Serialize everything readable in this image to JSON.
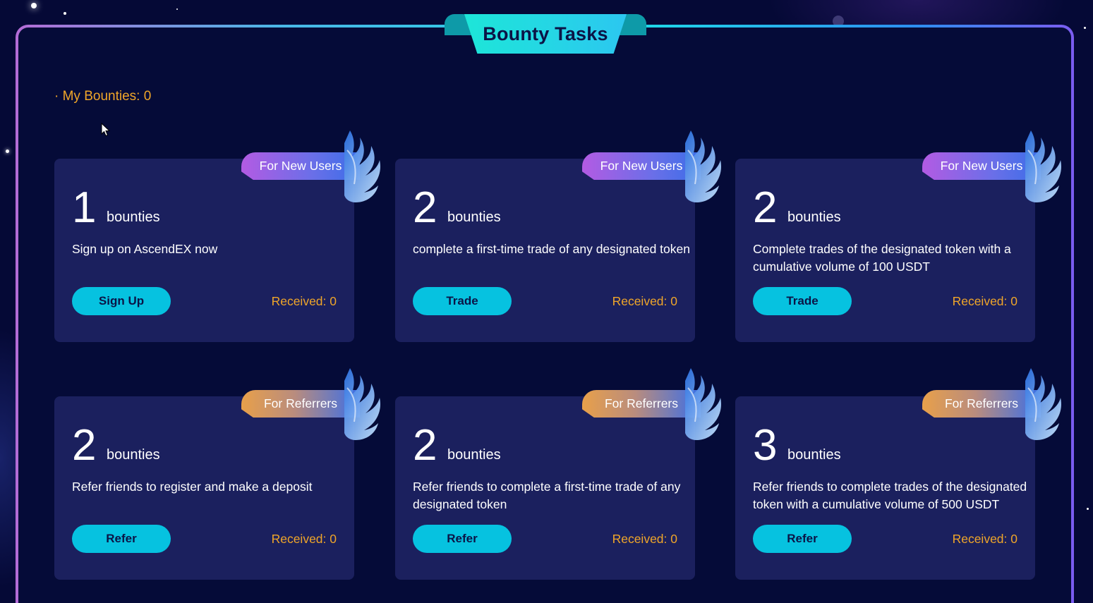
{
  "header": {
    "title": "Bounty Tasks"
  },
  "summary": {
    "my_bounties": "· My Bounties: 0"
  },
  "cards": [
    {
      "tag": "For New Users",
      "tag_type": "new",
      "count": "1",
      "unit": "bounties",
      "description": "Sign up on AscendEX now",
      "action": "Sign Up",
      "received": "Received: 0"
    },
    {
      "tag": "For New Users",
      "tag_type": "new",
      "count": "2",
      "unit": "bounties",
      "description": "complete a first-time trade of any designated token",
      "action": "Trade",
      "received": "Received: 0"
    },
    {
      "tag": "For New Users",
      "tag_type": "new",
      "count": "2",
      "unit": "bounties",
      "description": "Complete trades of the designated token with a cumulative volume of 100 USDT",
      "action": "Trade",
      "received": "Received: 0"
    },
    {
      "tag": "For Referrers",
      "tag_type": "ref",
      "count": "2",
      "unit": "bounties",
      "description": "Refer friends to register and make a deposit",
      "action": "Refer",
      "received": "Received: 0"
    },
    {
      "tag": "For Referrers",
      "tag_type": "ref",
      "count": "2",
      "unit": "bounties",
      "description": "Refer friends to complete a first-time trade of any designated token",
      "action": "Refer",
      "received": "Received: 0"
    },
    {
      "tag": "For Referrers",
      "tag_type": "ref",
      "count": "3",
      "unit": "bounties",
      "description": "Refer friends to complete trades of the designated token with a cumulative volume of 500 USDT",
      "action": "Refer",
      "received": "Received: 0"
    }
  ],
  "colors": {
    "background": "#050936",
    "card": "#1b205e",
    "button": "#06c2e0",
    "accent_orange": "#f0a629",
    "title_ribbon": "#1de6d8"
  },
  "icons": {
    "decoration": "wing-icon",
    "pointer": "mouse-cursor-icon"
  }
}
